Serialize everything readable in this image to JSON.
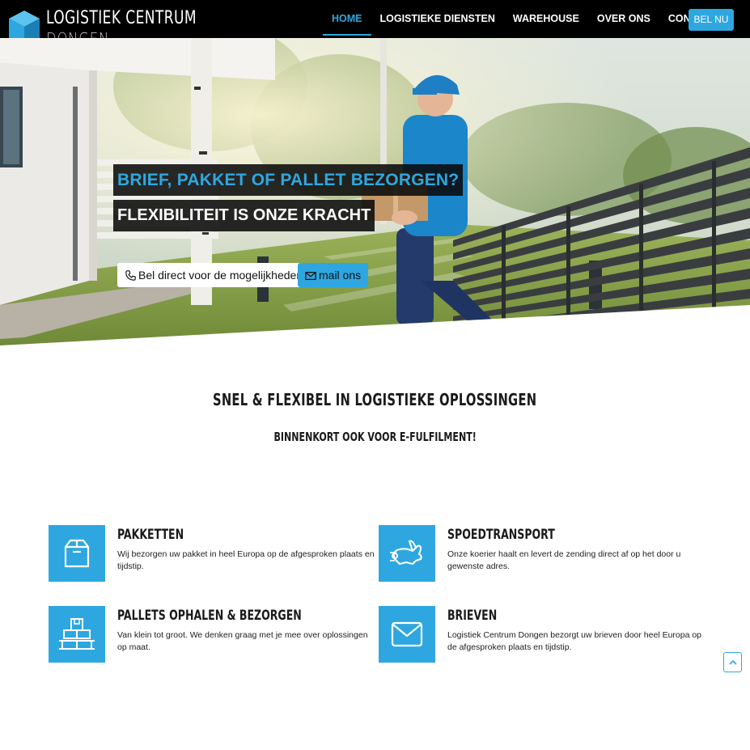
{
  "header": {
    "logo_line1": "LOGISTIEK CENTRUM",
    "logo_line2": "DONGEN",
    "nav": [
      "HOME",
      "LOGISTIEKE DIENSTEN",
      "WAREHOUSE",
      "OVER ONS",
      "CONTACT"
    ],
    "active_nav": "HOME",
    "cta": "BEL NU"
  },
  "hero": {
    "headline": "BRIEF, PAKKET OF PALLET BEZORGEN?",
    "subheadline": "FLEXIBILITEIT IS ONZE KRACHT",
    "call_button": "Bel direct voor de mogelijkheden",
    "mail_button": "mail ons",
    "call_icon": "phone-icon",
    "mail_icon": "envelope-icon"
  },
  "intro": {
    "title": "SNEL & FLEXIBEL IN LOGISTIEKE OPLOSSINGEN",
    "subtitle": "BINNENKORT OOK VOOR E-FULFILMENT!"
  },
  "services": [
    {
      "title": "PAKKETTEN",
      "desc": "Wij bezorgen uw pakket in heel Europa op de afgesproken plaats en tijdstip.",
      "icon": "package-icon"
    },
    {
      "title": "SPOEDTRANSPORT",
      "desc": "Onze koerier haalt en levert de zending direct af op het door u gewenste adres.",
      "icon": "rabbit-icon"
    },
    {
      "title": "PALLETS OPHALEN & BEZORGEN",
      "desc": "Van klein tot groot. We denken graag met je mee over oplossingen op maat.",
      "icon": "pallet-icon"
    },
    {
      "title": "BRIEVEN",
      "desc": "Logistiek Centrum Dongen bezorgt uw brieven door heel Europa op de afgesproken plaats en tijdstip.",
      "icon": "envelope-icon"
    }
  ],
  "colors": {
    "accent": "#2ea7e0",
    "header_bg": "#000000"
  }
}
